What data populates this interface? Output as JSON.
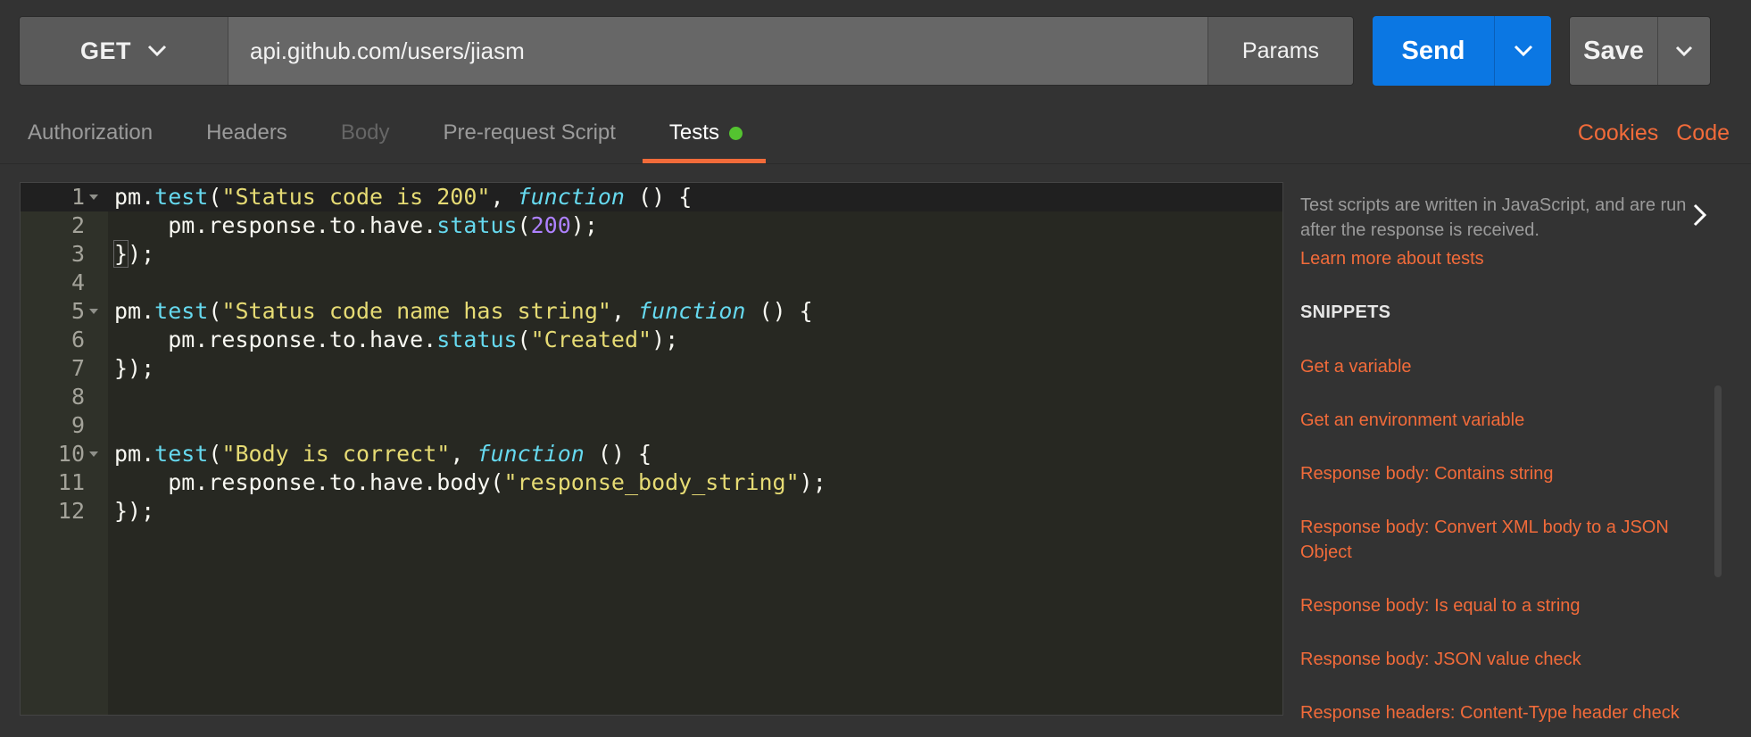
{
  "request": {
    "method": "GET",
    "url": "api.github.com/users/jiasm",
    "params_label": "Params",
    "send_label": "Send",
    "save_label": "Save"
  },
  "tabs": [
    {
      "label": "Authorization"
    },
    {
      "label": "Headers"
    },
    {
      "label": "Body"
    },
    {
      "label": "Pre-request Script"
    },
    {
      "label": "Tests"
    }
  ],
  "links": {
    "cookies": "Cookies",
    "code": "Code"
  },
  "editor": {
    "line_numbers": [
      "1",
      "2",
      "3",
      "4",
      "5",
      "6",
      "7",
      "8",
      "9",
      "10",
      "11",
      "12"
    ],
    "lines": [
      [
        "pm.",
        "test",
        "(",
        "\"Status code is 200\"",
        ", ",
        "function",
        " () {"
      ],
      [
        "    pm.response.to.have.",
        "status",
        "(",
        "200",
        ");"
      ],
      [
        "}",
        ");"
      ],
      [],
      [
        "pm.",
        "test",
        "(",
        "\"Status code name has string\"",
        ", ",
        "function",
        " () {"
      ],
      [
        "    pm.response.to.have.",
        "status",
        "(",
        "\"Created\"",
        ");"
      ],
      [
        "});"
      ],
      [],
      [],
      [
        "pm.",
        "test",
        "(",
        "\"Body is correct\"",
        ", ",
        "function",
        " () {"
      ],
      [
        "    pm.response.to.have.body(",
        "\"response_body_string\"",
        ");"
      ],
      [
        "});"
      ]
    ]
  },
  "panel": {
    "description": "Test scripts are written in JavaScript, and are run after the response is received.",
    "learn_more": "Learn more about tests",
    "snippets_title": "SNIPPETS",
    "snippets": [
      "Get a variable",
      "Get an environment variable",
      "Response body: Contains string",
      "Response body: Convert XML body to a JSON Object",
      "Response body: Is equal to a string",
      "Response body: JSON value check",
      "Response headers: Content-Type header check"
    ]
  },
  "colors": {
    "accent": "#f26b3a",
    "send": "#0b77e3",
    "status_dot": "#54c330"
  }
}
